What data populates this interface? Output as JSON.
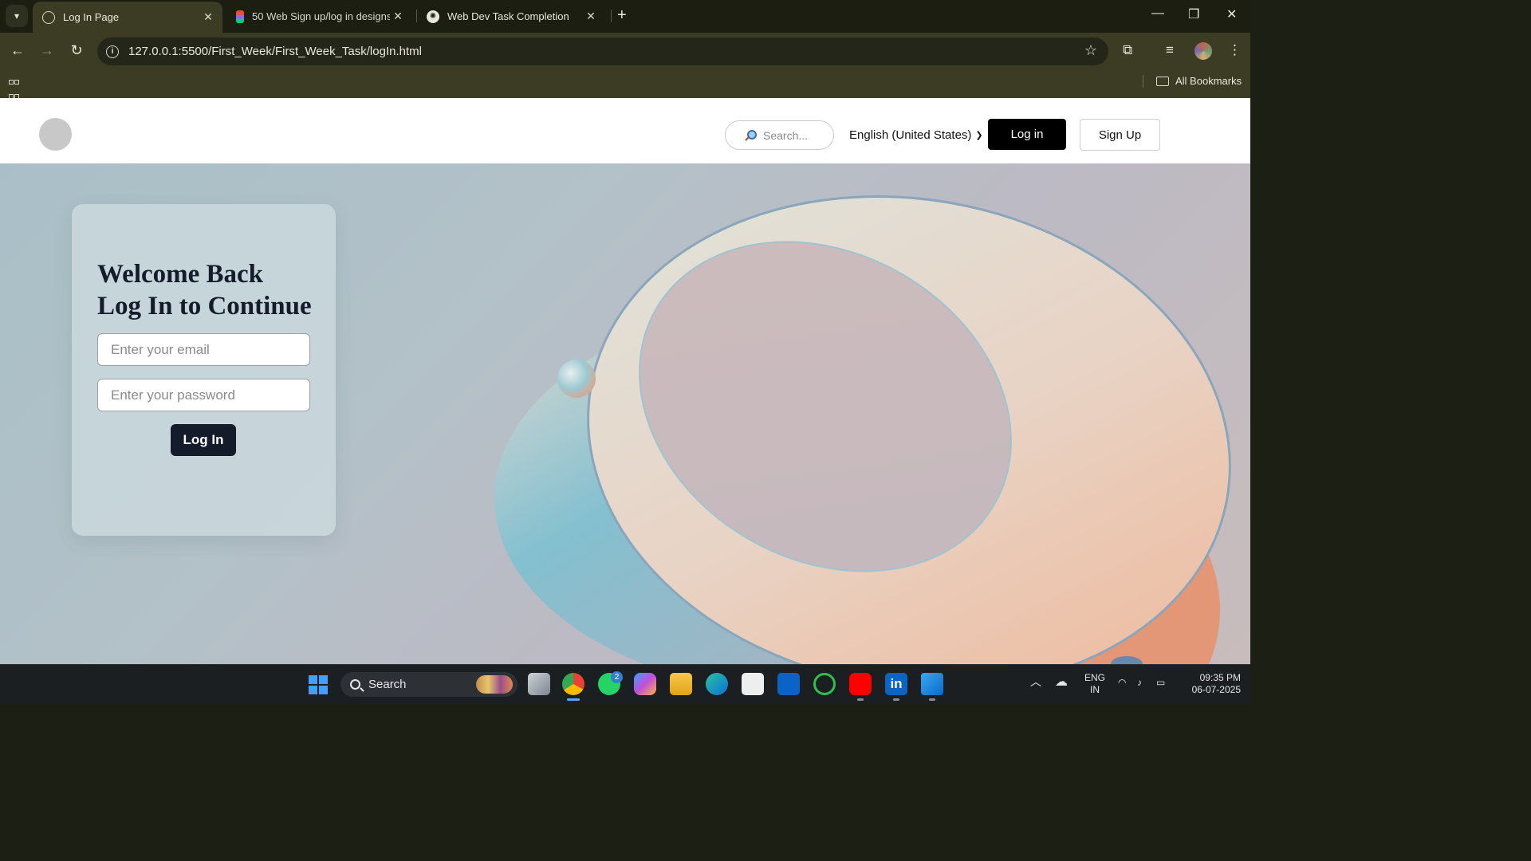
{
  "browser": {
    "tabs": [
      {
        "title": "Log In Page",
        "active": true,
        "icon": "globe-icon"
      },
      {
        "title": "50 Web Sign up/log in designs",
        "active": false,
        "icon": "figma-icon"
      },
      {
        "title": "Web Dev Task Completion",
        "active": false,
        "icon": "openai-icon"
      }
    ],
    "url": "127.0.0.1:5500/First_Week/First_Week_Task/logIn.html",
    "bookmarks_label": "All Bookmarks"
  },
  "site": {
    "search_placeholder": "Search...",
    "language": "English (United States)",
    "header_login": "Log in",
    "header_signup": "Sign Up"
  },
  "card": {
    "heading_line1": "Welcome Back",
    "heading_line2": "Log In to Continue",
    "email_placeholder": "Enter your email",
    "password_placeholder": "Enter your password",
    "login_button": "Log In"
  },
  "taskbar": {
    "search_label": "Search",
    "whatsapp_badge": "2",
    "lang_line1": "ENG",
    "lang_line2": "IN",
    "time": "09:35 PM",
    "date": "06-07-2025"
  },
  "colors": {
    "brand_dark": "#141b2a",
    "header_button": "#000000",
    "chrome_theme": "#3c3c24"
  }
}
